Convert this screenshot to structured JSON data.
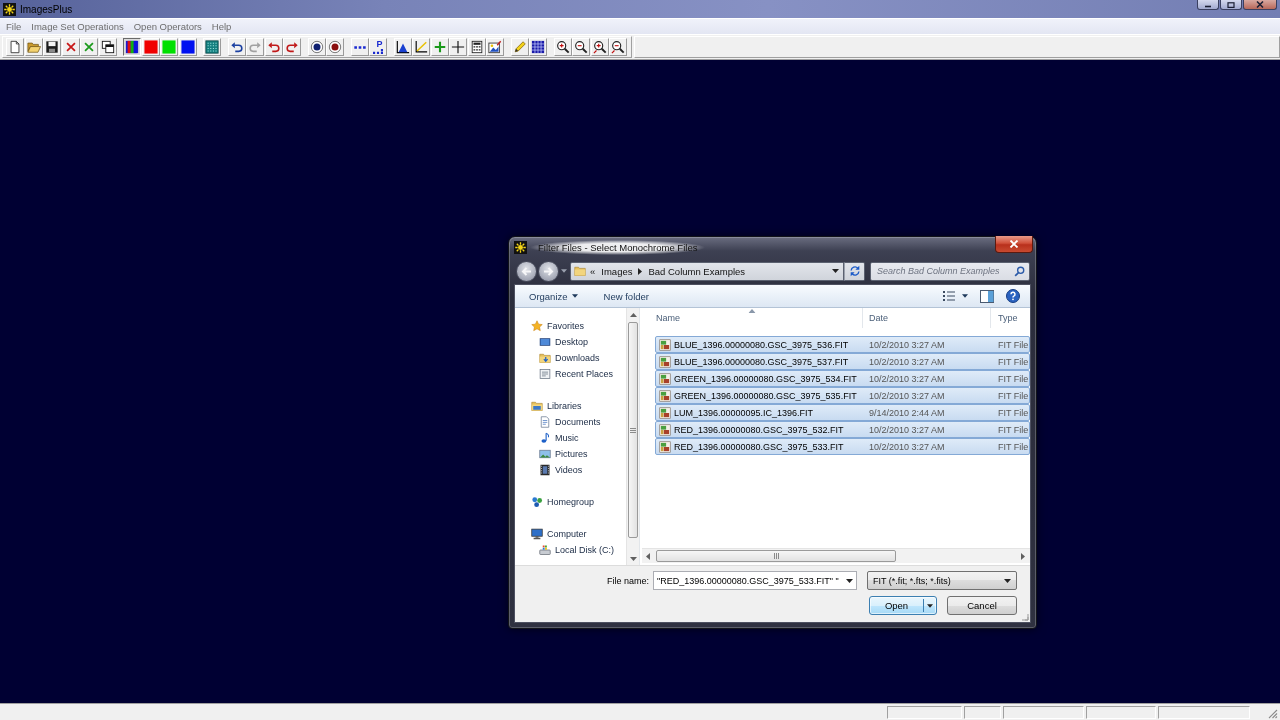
{
  "window": {
    "title": "ImagesPlus"
  },
  "menu": [
    "File",
    "Image Set Operations",
    "Open Operators",
    "Help"
  ],
  "toolbar": [
    [
      {
        "kind": "new",
        "pressed": false,
        "disabled": false
      },
      {
        "kind": "open",
        "pressed": false,
        "disabled": false
      },
      {
        "kind": "save",
        "pressed": false,
        "disabled": false
      },
      {
        "kind": "close",
        "pressed": false,
        "disabled": false
      },
      {
        "kind": "close_all",
        "pressed": false,
        "disabled": false
      },
      {
        "kind": "windows",
        "pressed": false,
        "disabled": false
      }
    ],
    [
      {
        "kind": "rgb",
        "pressed": true,
        "disabled": false
      },
      {
        "kind": "red_channel",
        "pressed": false,
        "disabled": false
      },
      {
        "kind": "green_channel",
        "pressed": false,
        "disabled": false
      },
      {
        "kind": "blue_channel",
        "pressed": false,
        "disabled": false
      }
    ],
    [
      {
        "kind": "dot_grid",
        "pressed": false,
        "disabled": false
      }
    ],
    [
      {
        "kind": "undo",
        "pressed": false,
        "disabled": false
      },
      {
        "kind": "redo",
        "pressed": false,
        "disabled": true
      },
      {
        "kind": "undo_all",
        "pressed": false,
        "disabled": false
      },
      {
        "kind": "redo_all",
        "pressed": false,
        "disabled": false
      }
    ],
    [
      {
        "kind": "circle_blue",
        "pressed": false,
        "disabled": false
      },
      {
        "kind": "circle_red",
        "pressed": false,
        "disabled": false
      }
    ],
    [
      {
        "kind": "points",
        "pressed": false,
        "disabled": false
      },
      {
        "kind": "points_labeled",
        "label": "P",
        "pressed": false,
        "disabled": false
      }
    ],
    [
      {
        "kind": "histogram",
        "pressed": false,
        "disabled": false
      },
      {
        "kind": "curve",
        "pressed": false,
        "disabled": false
      },
      {
        "kind": "plus",
        "pressed": false,
        "disabled": false
      },
      {
        "kind": "crosshair",
        "pressed": false,
        "disabled": false
      },
      {
        "kind": "calculator",
        "pressed": false,
        "disabled": false
      },
      {
        "kind": "picture",
        "pressed": false,
        "disabled": false
      }
    ],
    [
      {
        "kind": "pencil",
        "pressed": false,
        "disabled": false
      },
      {
        "kind": "grid",
        "pressed": false,
        "disabled": false
      }
    ],
    [
      {
        "kind": "zoom_in",
        "pressed": false,
        "disabled": false
      },
      {
        "kind": "zoom_out",
        "pressed": false,
        "disabled": false
      },
      {
        "kind": "zoom_in_step",
        "pressed": false,
        "disabled": false
      },
      {
        "kind": "zoom_out_step",
        "pressed": false,
        "disabled": false
      }
    ]
  ],
  "dialog": {
    "title": "Filter Files - Select Monochrome Files",
    "address": {
      "overflow": "«",
      "path": [
        "Images",
        "Bad Column Examples"
      ]
    },
    "search": {
      "placeholder": "Search Bad Column Examples"
    },
    "commands": [
      {
        "label": "Organize",
        "menu": true
      },
      {
        "label": "New folder",
        "menu": false
      }
    ],
    "nav": [
      {
        "label": "Favorites",
        "children": [
          {
            "label": "Desktop"
          },
          {
            "label": "Downloads"
          },
          {
            "label": "Recent Places"
          }
        ]
      },
      {
        "label": "Libraries",
        "children": [
          {
            "label": "Documents"
          },
          {
            "label": "Music"
          },
          {
            "label": "Pictures"
          },
          {
            "label": "Videos"
          }
        ]
      },
      {
        "label": "Homegroup"
      },
      {
        "label": "Computer",
        "children": [
          {
            "label": "Local Disk (C:)"
          }
        ]
      }
    ],
    "columns": [
      {
        "label": "Name",
        "sorted": true
      },
      {
        "label": "Date",
        "sorted": false
      },
      {
        "label": "Type",
        "sorted": false
      }
    ],
    "files": [
      {
        "name": "BLUE_1396.00000080.GSC_3975_536.FIT",
        "date": "10/2/2010 3:27 AM",
        "type": "FIT File",
        "selected": true
      },
      {
        "name": "BLUE_1396.00000080.GSC_3975_537.FIT",
        "date": "10/2/2010 3:27 AM",
        "type": "FIT File",
        "selected": true
      },
      {
        "name": "GREEN_1396.00000080.GSC_3975_534.FIT",
        "date": "10/2/2010 3:27 AM",
        "type": "FIT File",
        "selected": true
      },
      {
        "name": "GREEN_1396.00000080.GSC_3975_535.FIT",
        "date": "10/2/2010 3:27 AM",
        "type": "FIT File",
        "selected": true
      },
      {
        "name": "LUM_1396.00000095.IC_1396.FIT",
        "date": "9/14/2010 2:44 AM",
        "type": "FIT File",
        "selected": true
      },
      {
        "name": "RED_1396.00000080.GSC_3975_532.FIT",
        "date": "10/2/2010 3:27 AM",
        "type": "FIT File",
        "selected": true
      },
      {
        "name": "RED_1396.00000080.GSC_3975_533.FIT",
        "date": "10/2/2010 3:27 AM",
        "type": "FIT File",
        "selected": true
      }
    ],
    "file_name": {
      "label": "File name:",
      "value": "\"RED_1396.00000080.GSC_3975_533.FIT\" \""
    },
    "file_type": {
      "value": "FIT (*.fit; *.fts; *.fits)"
    },
    "buttons": [
      {
        "label": "Open",
        "default": true,
        "split": true
      },
      {
        "label": "Cancel",
        "default": false,
        "split": false
      }
    ]
  }
}
